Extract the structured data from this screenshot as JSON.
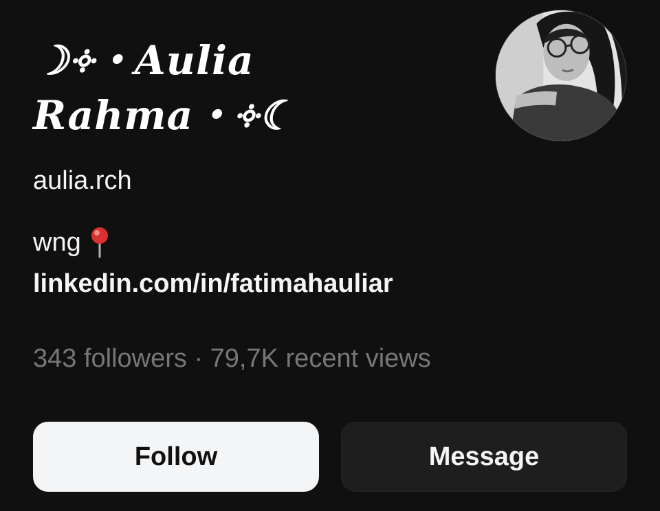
{
  "profile": {
    "display_name_line1": "☽༓・Aulia",
    "display_name_line2": "Rahma・༓☾",
    "username": "aulia.rch",
    "bio_text": "wng",
    "bio_icon": "round-pushpin-icon",
    "link": "linkedin.com/in/fatimahauliar",
    "stats": "343 followers · 79,7K recent views",
    "avatar": "profile-photo"
  },
  "actions": {
    "follow_label": "Follow",
    "message_label": "Message"
  },
  "colors": {
    "background": "#101010",
    "primary_text": "#f3f5f7",
    "secondary_text": "#777777",
    "follow_bg": "#f3f5f7",
    "message_bg": "#1e1e1e",
    "pin_red": "#d9312f"
  }
}
